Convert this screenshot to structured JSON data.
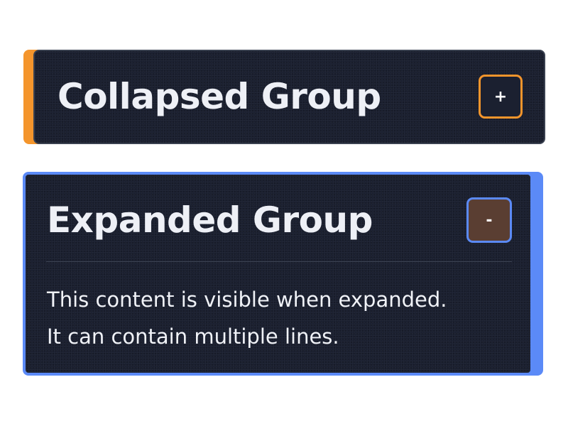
{
  "colors": {
    "panel_bg": "#1b2030",
    "collapsed_accent": "#f4952c",
    "expanded_accent": "#5b8af7",
    "expanded_toggle_bg": "#5a3e32",
    "text": "#eef0f6"
  },
  "groups": [
    {
      "state": "collapsed",
      "title": "Collapsed Group",
      "toggle_label": "+"
    },
    {
      "state": "expanded",
      "title": "Expanded Group",
      "toggle_label": "-",
      "content_lines": [
        "This content is visible when expanded.",
        "It can contain multiple lines."
      ]
    }
  ]
}
